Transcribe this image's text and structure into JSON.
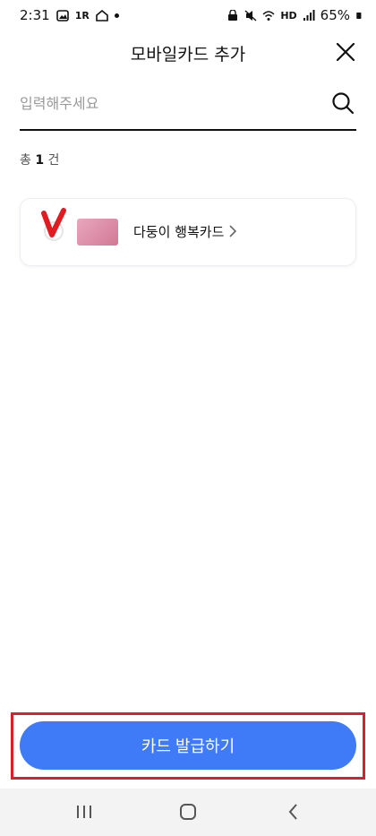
{
  "status_bar": {
    "time": "2:31",
    "carrier_badge": "1R",
    "hd_label": "HD",
    "battery": "65%"
  },
  "header": {
    "title": "모바일카드 추가"
  },
  "search": {
    "placeholder": "입력해주세요",
    "value": ""
  },
  "results": {
    "prefix": "총",
    "count": "1",
    "suffix": "건"
  },
  "cards": [
    {
      "name": "다둥이 행복카드"
    }
  ],
  "footer": {
    "issue_button_label": "카드 발급하기"
  },
  "colors": {
    "accent": "#3f7bf6",
    "highlight_frame": "#d9202b",
    "check": "#e11b22"
  }
}
